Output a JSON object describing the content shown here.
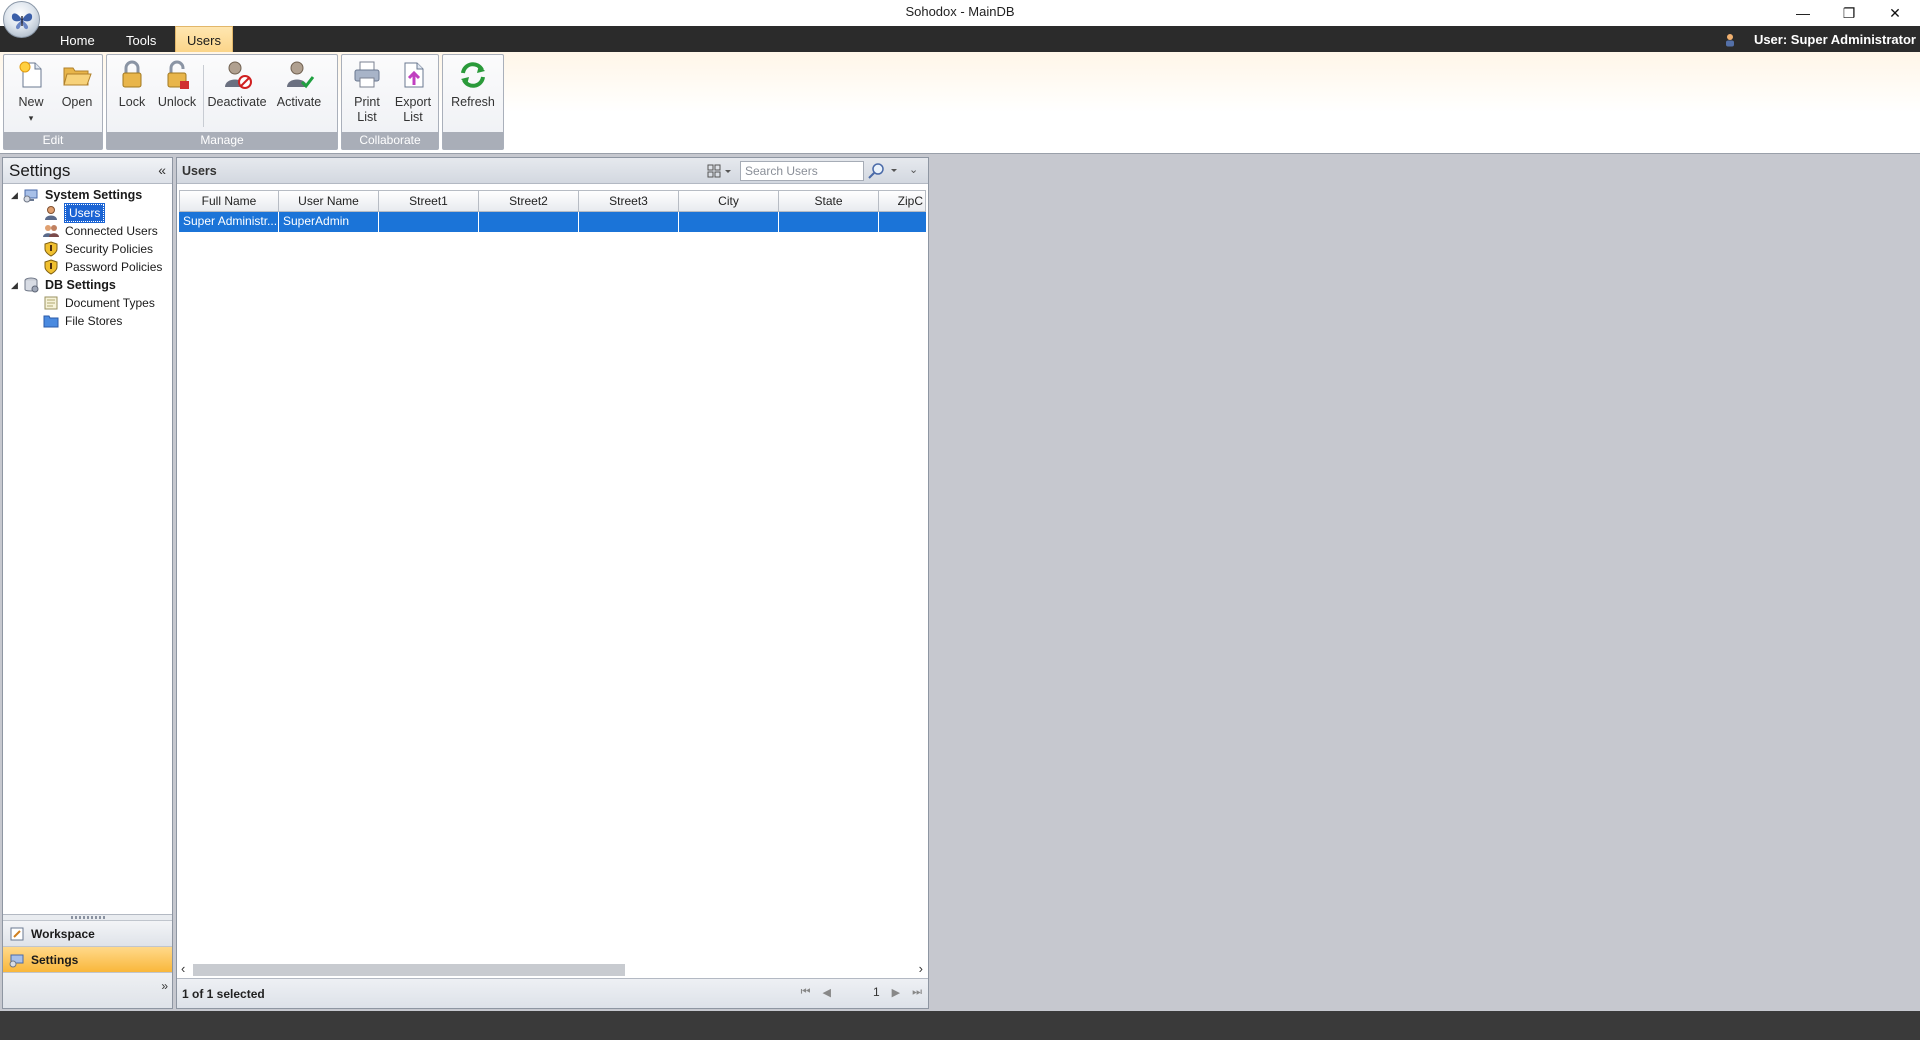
{
  "window": {
    "title": "Sohodox - MainDB",
    "min_glyph": "—",
    "max_glyph": "❐",
    "close_glyph": "✕"
  },
  "tabs": {
    "home": "Home",
    "tools": "Tools",
    "users": "Users"
  },
  "user_label": "User: Super Administrator",
  "ribbon": {
    "groups": {
      "edit": "Edit",
      "manage": "Manage",
      "collaborate": "Collaborate"
    },
    "buttons": {
      "new": "New",
      "new_dropdown": "▾",
      "open": "Open",
      "lock": "Lock",
      "unlock": "Unlock",
      "deactivate": "Deactivate",
      "activate": "Activate",
      "print_list_1": "Print",
      "print_list_2": "List",
      "export_list_1": "Export",
      "export_list_2": "List",
      "refresh": "Refresh"
    }
  },
  "left_panel": {
    "title": "Settings",
    "collapse_glyph": "«",
    "tree": {
      "system_settings": "System Settings",
      "users": "Users",
      "connected_users": "Connected Users",
      "security_policies": "Security Policies",
      "password_policies": "Password Policies",
      "db_settings": "DB Settings",
      "document_types": "Document Types",
      "file_stores": "File Stores"
    },
    "nav": {
      "workspace": "Workspace",
      "settings": "Settings",
      "more_glyph": "»"
    }
  },
  "users_panel": {
    "title": "Users",
    "search_placeholder": "Search Users",
    "expand_glyph": "⌄",
    "columns": [
      "Full Name",
      "User Name",
      "Street1",
      "Street2",
      "Street3",
      "City",
      "State",
      "ZipC"
    ],
    "rows": [
      [
        "Super Administr...",
        "SuperAdmin",
        "",
        "",
        "",
        "",
        "",
        ""
      ]
    ],
    "status": "1 of 1 selected",
    "page": "1",
    "scroll_left": "‹",
    "scroll_right": "›"
  },
  "colors": {
    "selection": "#1b74d8",
    "active_tab": "#fbd58a",
    "nav_active": "#f9b73b"
  }
}
